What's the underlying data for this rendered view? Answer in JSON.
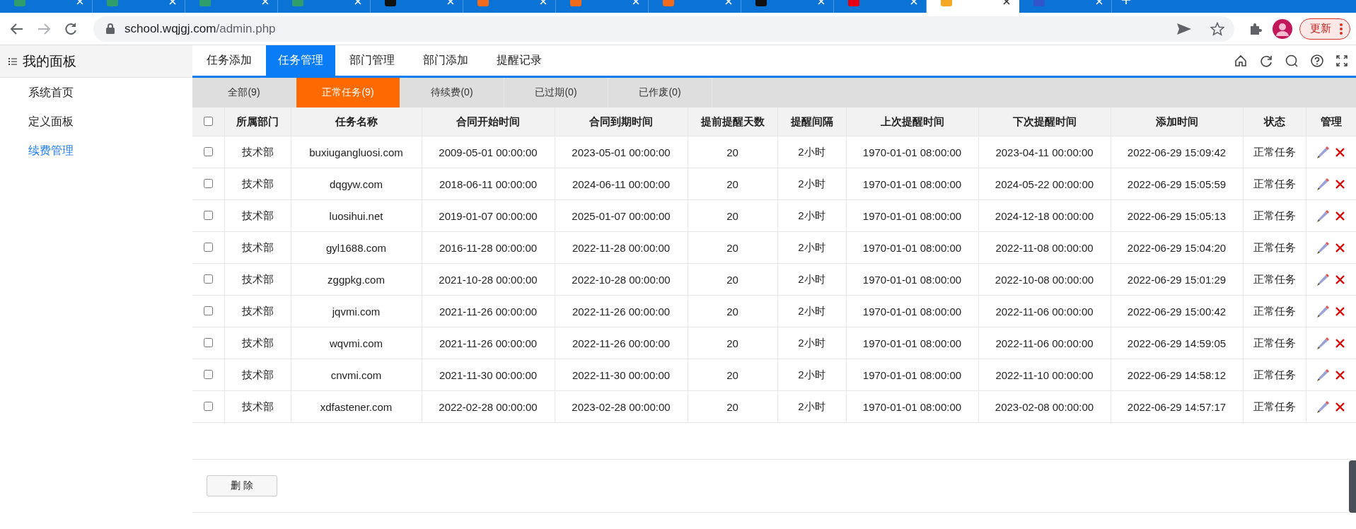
{
  "browser": {
    "tabs": [
      {
        "color": "#2f9e6b",
        "selected": false
      },
      {
        "color": "#2f9e6b",
        "selected": false
      },
      {
        "color": "#2f9e6b",
        "selected": false
      },
      {
        "color": "#2f9e6b",
        "selected": false
      },
      {
        "color": "#111111",
        "selected": false
      },
      {
        "color": "#f26a1b",
        "selected": false
      },
      {
        "color": "#f26a1b",
        "selected": false
      },
      {
        "color": "#f26a1b",
        "selected": false
      },
      {
        "color": "#111111",
        "selected": false
      },
      {
        "color": "#e60012",
        "selected": false
      },
      {
        "color": "#f5a623",
        "selected": true
      },
      {
        "color": "#3355cc",
        "selected": false
      }
    ],
    "url_host": "school.wqjgj.com",
    "url_path": "/admin.php",
    "update_button": "更新"
  },
  "sidebar": {
    "title": "我的面板",
    "items": [
      {
        "label": "系统首页",
        "selected": false
      },
      {
        "label": "定义面板",
        "selected": false
      },
      {
        "label": "续费管理",
        "selected": true
      }
    ]
  },
  "nav": {
    "tabs": [
      {
        "label": "任务添加",
        "selected": false
      },
      {
        "label": "任务管理",
        "selected": true
      },
      {
        "label": "部门管理",
        "selected": false
      },
      {
        "label": "部门添加",
        "selected": false
      },
      {
        "label": "提醒记录",
        "selected": false
      }
    ]
  },
  "subtabs": [
    {
      "label": "全部(9)",
      "selected": false
    },
    {
      "label": "正常任务(9)",
      "selected": true
    },
    {
      "label": "待续费(0)",
      "selected": false
    },
    {
      "label": "已过期(0)",
      "selected": false
    },
    {
      "label": "已作废(0)",
      "selected": false
    }
  ],
  "table": {
    "select_all_checked": false,
    "columns": [
      "所属部门",
      "任务名称",
      "合同开始时间",
      "合同到期时间",
      "提前提醒天数",
      "提醒间隔",
      "上次提醒时间",
      "下次提醒时间",
      "添加时间",
      "状态",
      "管理"
    ],
    "rows": [
      {
        "checked": false,
        "cells": [
          "技术部",
          "buxiugangluosi.com",
          "2009-05-01 00:00:00",
          "2023-05-01 00:00:00",
          "20",
          "2小时",
          "1970-01-01 08:00:00",
          "2023-04-11 00:00:00",
          "2022-06-29 15:09:42",
          "正常任务"
        ]
      },
      {
        "checked": false,
        "cells": [
          "技术部",
          "dqgyw.com",
          "2018-06-11 00:00:00",
          "2024-06-11 00:00:00",
          "20",
          "2小时",
          "1970-01-01 08:00:00",
          "2024-05-22 00:00:00",
          "2022-06-29 15:05:59",
          "正常任务"
        ]
      },
      {
        "checked": false,
        "cells": [
          "技术部",
          "luosihui.net",
          "2019-01-07 00:00:00",
          "2025-01-07 00:00:00",
          "20",
          "2小时",
          "1970-01-01 08:00:00",
          "2024-12-18 00:00:00",
          "2022-06-29 15:05:13",
          "正常任务"
        ]
      },
      {
        "checked": false,
        "cells": [
          "技术部",
          "gyl1688.com",
          "2016-11-28 00:00:00",
          "2022-11-28 00:00:00",
          "20",
          "2小时",
          "1970-01-01 08:00:00",
          "2022-11-08 00:00:00",
          "2022-06-29 15:04:20",
          "正常任务"
        ]
      },
      {
        "checked": false,
        "cells": [
          "技术部",
          "zggpkg.com",
          "2021-10-28 00:00:00",
          "2022-10-28 00:00:00",
          "20",
          "2小时",
          "1970-01-01 08:00:00",
          "2022-10-08 00:00:00",
          "2022-06-29 15:01:29",
          "正常任务"
        ]
      },
      {
        "checked": false,
        "cells": [
          "技术部",
          "jqvmi.com",
          "2021-11-26 00:00:00",
          "2022-11-26 00:00:00",
          "20",
          "2小时",
          "1970-01-01 08:00:00",
          "2022-11-06 00:00:00",
          "2022-06-29 15:00:42",
          "正常任务"
        ]
      },
      {
        "checked": false,
        "cells": [
          "技术部",
          "wqvmi.com",
          "2021-11-26 00:00:00",
          "2022-11-26 00:00:00",
          "20",
          "2小时",
          "1970-01-01 08:00:00",
          "2022-11-06 00:00:00",
          "2022-06-29 14:59:05",
          "正常任务"
        ]
      },
      {
        "checked": false,
        "cells": [
          "技术部",
          "cnvmi.com",
          "2021-11-30 00:00:00",
          "2022-11-30 00:00:00",
          "20",
          "2小时",
          "1970-01-01 08:00:00",
          "2022-11-10 00:00:00",
          "2022-06-29 14:58:12",
          "正常任务"
        ]
      },
      {
        "checked": false,
        "cells": [
          "技术部",
          "xdfastener.com",
          "2022-02-28 00:00:00",
          "2023-02-28 00:00:00",
          "20",
          "2小时",
          "1970-01-01 08:00:00",
          "2023-02-08 00:00:00",
          "2022-06-29 14:57:17",
          "正常任务"
        ]
      }
    ]
  },
  "delete_button": "删 除"
}
